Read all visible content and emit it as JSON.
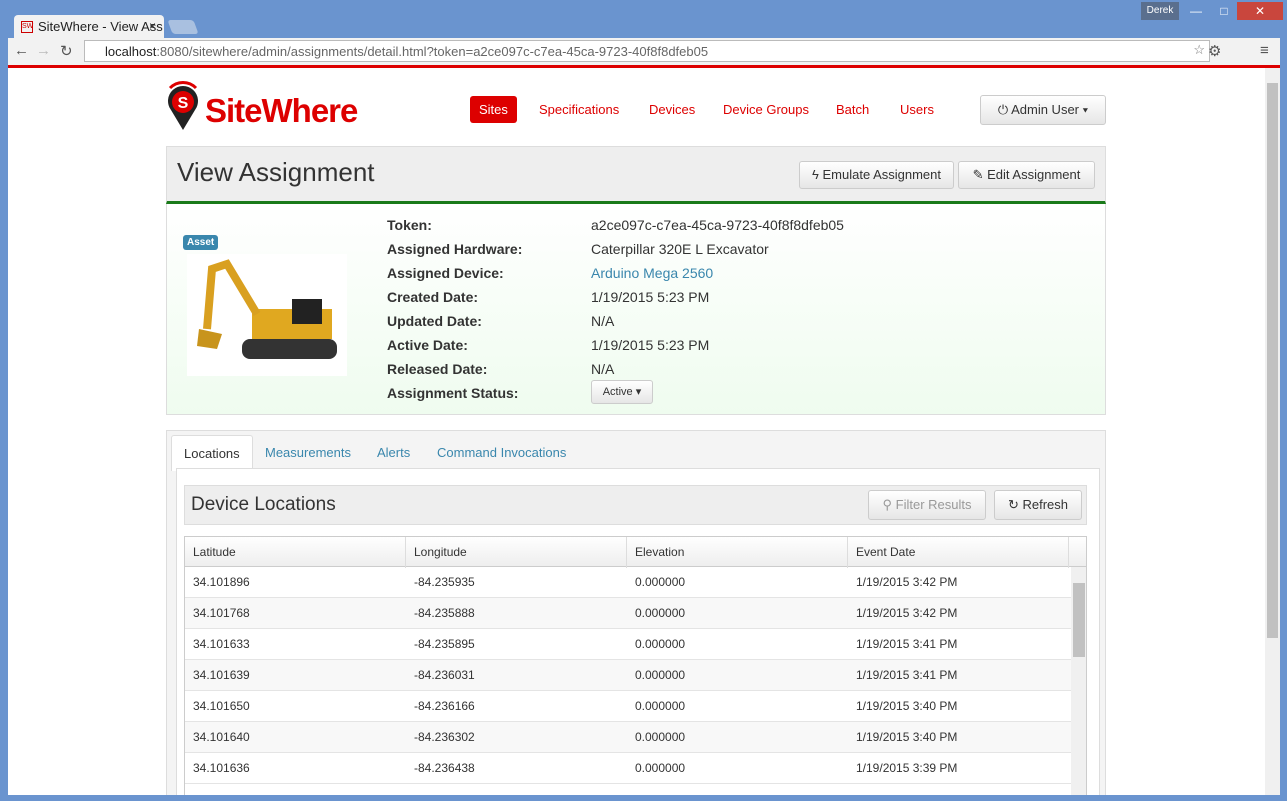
{
  "browser": {
    "tab_title": "SiteWhere - View Ass",
    "favicon": "SW",
    "user": "Derek",
    "url_host": "localhost",
    "url_rest": ":8080/sitewhere/admin/assignments/detail.html?token=a2ce097c-c7ea-45ca-9723-40f8f8dfeb05"
  },
  "brand": {
    "name": "SiteWhere",
    "accent": "#dd0000"
  },
  "nav": {
    "items": [
      {
        "label": "Sites",
        "active": true
      },
      {
        "label": "Specifications"
      },
      {
        "label": "Devices"
      },
      {
        "label": "Device Groups"
      },
      {
        "label": "Batch"
      },
      {
        "label": "Users"
      }
    ],
    "user_button": "Admin User"
  },
  "header": {
    "title": "View Assignment",
    "emulate": "Emulate Assignment",
    "edit": "Edit Assignment"
  },
  "details": {
    "badge": "Asset",
    "fields": [
      {
        "label": "Token:",
        "value": "a2ce097c-c7ea-45ca-9723-40f8f8dfeb05"
      },
      {
        "label": "Assigned Hardware:",
        "value": "Caterpillar 320E L Excavator"
      },
      {
        "label": "Assigned Device:",
        "value": "Arduino Mega 2560",
        "link": true
      },
      {
        "label": "Created Date:",
        "value": "1/19/2015 5:23 PM"
      },
      {
        "label": "Updated Date:",
        "value": "N/A"
      },
      {
        "label": "Active Date:",
        "value": "1/19/2015 5:23 PM"
      },
      {
        "label": "Released Date:",
        "value": "N/A"
      },
      {
        "label": "Assignment Status:",
        "value": "Active"
      }
    ]
  },
  "tabs": [
    "Locations",
    "Measurements",
    "Alerts",
    "Command Invocations"
  ],
  "locations": {
    "title": "Device Locations",
    "filter": "Filter Results",
    "refresh": "Refresh",
    "columns": [
      "Latitude",
      "Longitude",
      "Elevation",
      "Event Date"
    ],
    "rows": [
      [
        "34.101896",
        "-84.235935",
        "0.000000",
        "1/19/2015 3:42 PM"
      ],
      [
        "34.101768",
        "-84.235888",
        "0.000000",
        "1/19/2015 3:42 PM"
      ],
      [
        "34.101633",
        "-84.235895",
        "0.000000",
        "1/19/2015 3:41 PM"
      ],
      [
        "34.101639",
        "-84.236031",
        "0.000000",
        "1/19/2015 3:41 PM"
      ],
      [
        "34.101650",
        "-84.236166",
        "0.000000",
        "1/19/2015 3:40 PM"
      ],
      [
        "34.101640",
        "-84.236302",
        "0.000000",
        "1/19/2015 3:40 PM"
      ],
      [
        "34.101636",
        "-84.236438",
        "0.000000",
        "1/19/2015 3:39 PM"
      ]
    ]
  }
}
